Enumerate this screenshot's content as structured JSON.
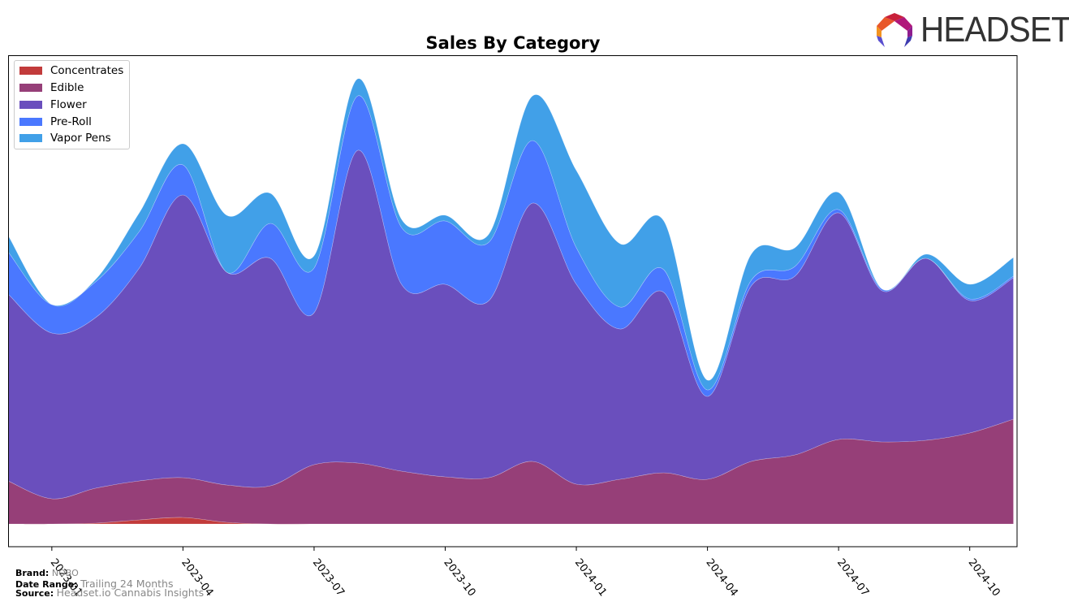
{
  "header": {
    "logo_text": "HEADSET"
  },
  "footer": {
    "brand_label": "Brand:",
    "brand_value": "NOBO",
    "date_range_label": "Date Range:",
    "date_range_value": "Trailing 24 Months",
    "source_label": "Source:",
    "source_value": "Headset.io Cannabis Insights"
  },
  "chart_data": {
    "type": "area",
    "stacked": true,
    "smoothed": true,
    "title": "Sales By Category",
    "xlabel": "",
    "ylabel": "",
    "y_ticks_shown": false,
    "grid": false,
    "legend_position": "top-left",
    "x": [
      "2022-12",
      "2023-01",
      "2023-02",
      "2023-03",
      "2023-04",
      "2023-05",
      "2023-06",
      "2023-07",
      "2023-08",
      "2023-09",
      "2023-10",
      "2023-11",
      "2023-12",
      "2024-01",
      "2024-02",
      "2024-03",
      "2024-04",
      "2024-05",
      "2024-06",
      "2024-07",
      "2024-08",
      "2024-09",
      "2024-10",
      "2024-11"
    ],
    "x_tick_labels": [
      "2023-01",
      "2023-04",
      "2023-07",
      "2023-10",
      "2024-01",
      "2024-04",
      "2024-07",
      "2024-10"
    ],
    "ylim": [
      0,
      118
    ],
    "series": [
      {
        "name": "Concentrates",
        "color": "#c23b3b",
        "values": [
          0,
          0,
          0.2,
          1.0,
          1.6,
          0.4,
          0,
          0,
          0,
          0,
          0,
          0,
          0,
          0,
          0,
          0,
          0,
          0,
          0,
          0,
          0,
          0,
          0,
          0
        ]
      },
      {
        "name": "Edible",
        "color": "#963f78",
        "values": [
          10.6,
          6.2,
          8.6,
          9.6,
          9.8,
          9.2,
          9.4,
          14.6,
          15.0,
          13.0,
          11.6,
          11.4,
          15.4,
          9.8,
          11.0,
          12.6,
          11.0,
          15.4,
          17.0,
          20.8,
          20.2,
          20.6,
          22.4,
          25.8
        ]
      },
      {
        "name": "Flower",
        "color": "#6a4fbd",
        "values": [
          46.0,
          40.8,
          42.0,
          52.4,
          69.6,
          52.4,
          56.0,
          37.4,
          77.0,
          46.0,
          47.4,
          43.6,
          63.6,
          49.2,
          37.0,
          44.4,
          20.4,
          43.2,
          44.0,
          55.8,
          37.2,
          44.8,
          32.6,
          34.8
        ]
      },
      {
        "name": "Pre-Roll",
        "color": "#4a78ff",
        "values": [
          10.4,
          7.0,
          8.8,
          9.0,
          7.4,
          0,
          8.6,
          11.0,
          13.4,
          14.0,
          15.6,
          14.4,
          15.4,
          9.0,
          5.4,
          5.6,
          1.6,
          1.4,
          2.4,
          0.8,
          0.4,
          0,
          0.4,
          0.4
        ]
      },
      {
        "name": "Vapor Pens",
        "color": "#41a0e8",
        "values": [
          4.0,
          0,
          0.6,
          4.6,
          5.2,
          14.0,
          7.4,
          3.0,
          4.2,
          2.0,
          1.4,
          2.0,
          11.0,
          19.0,
          15.6,
          12.0,
          2.4,
          6.4,
          4.6,
          4.2,
          0,
          1.0,
          3.6,
          4.6
        ]
      }
    ]
  }
}
